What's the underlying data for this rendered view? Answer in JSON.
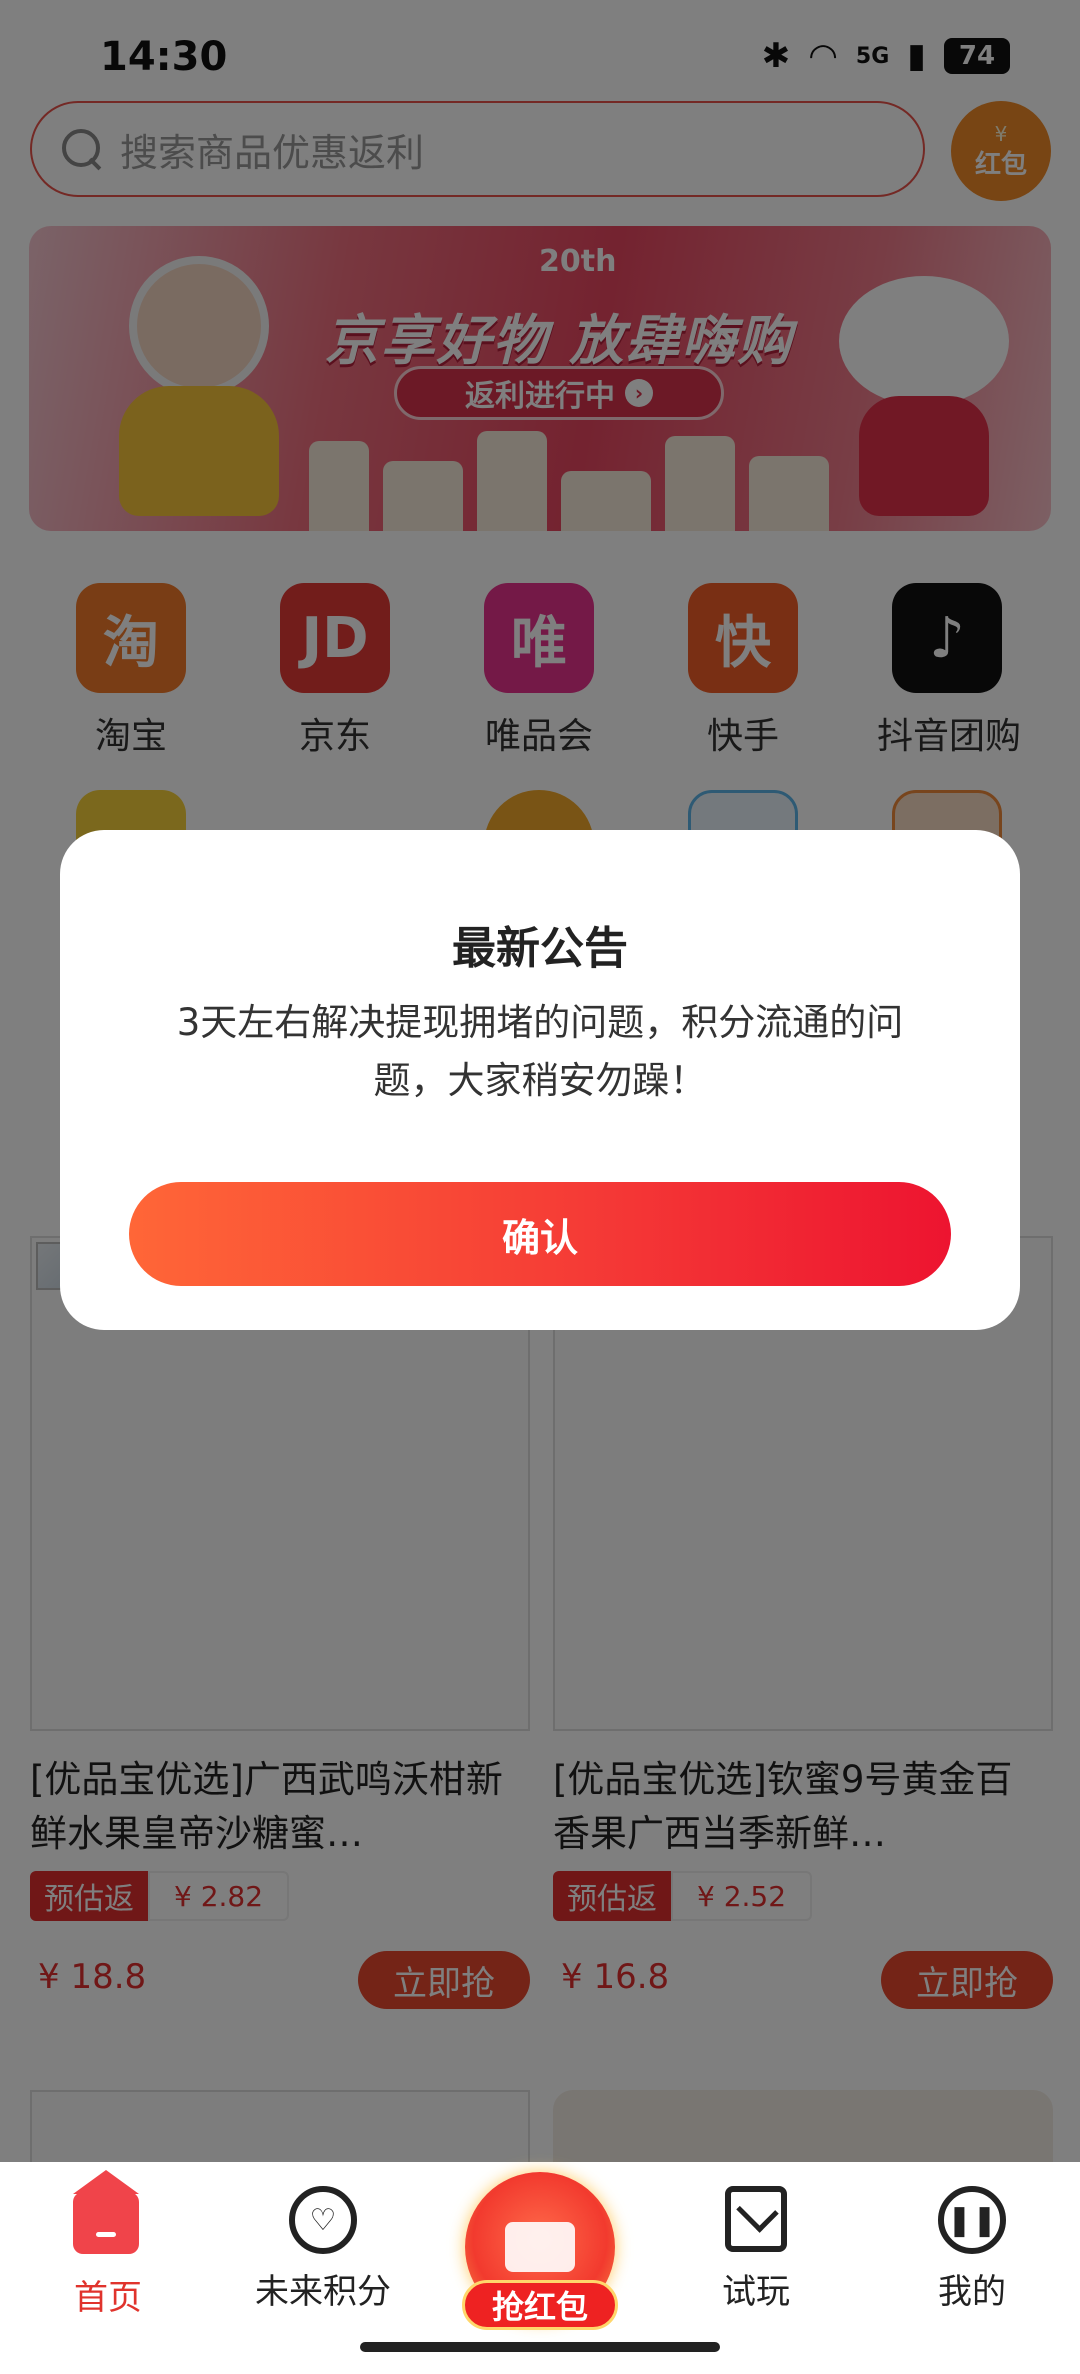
{
  "status_bar": {
    "time": "14:30",
    "network": "5G",
    "battery": "74"
  },
  "search": {
    "placeholder": "搜索商品优惠返利"
  },
  "redpacket_button": {
    "symbol": "¥",
    "label": "红包"
  },
  "banner": {
    "badge": "20th",
    "title": "京享好物 放肆嗨购",
    "cta": "返利进行中"
  },
  "platforms": [
    {
      "label": "淘宝",
      "icon": "taobao-icon",
      "glyph": "淘",
      "color": "#f27a2a"
    },
    {
      "label": "京东",
      "icon": "jd-icon",
      "glyph": "JD",
      "color": "#e43a37"
    },
    {
      "label": "唯品会",
      "icon": "vipshop-icon",
      "glyph": "唯",
      "color": "#e9338e"
    },
    {
      "label": "快手",
      "icon": "kuaishou-icon",
      "glyph": "快",
      "color": "#f25f28"
    },
    {
      "label": "抖音团购",
      "icon": "douyin-icon",
      "glyph": "♪",
      "color": "#111111"
    }
  ],
  "products": [
    {
      "title": "[优品宝优选]广西武鸣沃柑新鲜水果皇帝沙糖蜜…",
      "rebate_label": "预估返",
      "rebate_value": "¥ 2.82",
      "price": "¥ 18.8",
      "buy_label": "立即抢"
    },
    {
      "title": "[优品宝优选]钦蜜9号黄金百香果广西当季新鲜…",
      "rebate_label": "预估返",
      "rebate_value": "¥ 2.52",
      "price": "¥ 16.8",
      "buy_label": "立即抢"
    }
  ],
  "dialog": {
    "title": "最新公告",
    "body": "3天左右解决提现拥堵的问题，积分流通的问题，大家稍安勿躁！",
    "confirm": "确认"
  },
  "tabs": [
    {
      "label": "首页",
      "icon": "home-icon",
      "active": true
    },
    {
      "label": "未来积分",
      "icon": "heart-circle-icon",
      "active": false
    },
    {
      "label": "抢红包",
      "icon": "red-envelope-icon",
      "active": false
    },
    {
      "label": "试玩",
      "icon": "mail-icon",
      "active": false
    },
    {
      "label": "我的",
      "icon": "profile-face-icon",
      "active": false
    }
  ],
  "colors": {
    "accent": "#e0332c",
    "button_start": "#ff6637",
    "button_end": "#ed1430"
  }
}
